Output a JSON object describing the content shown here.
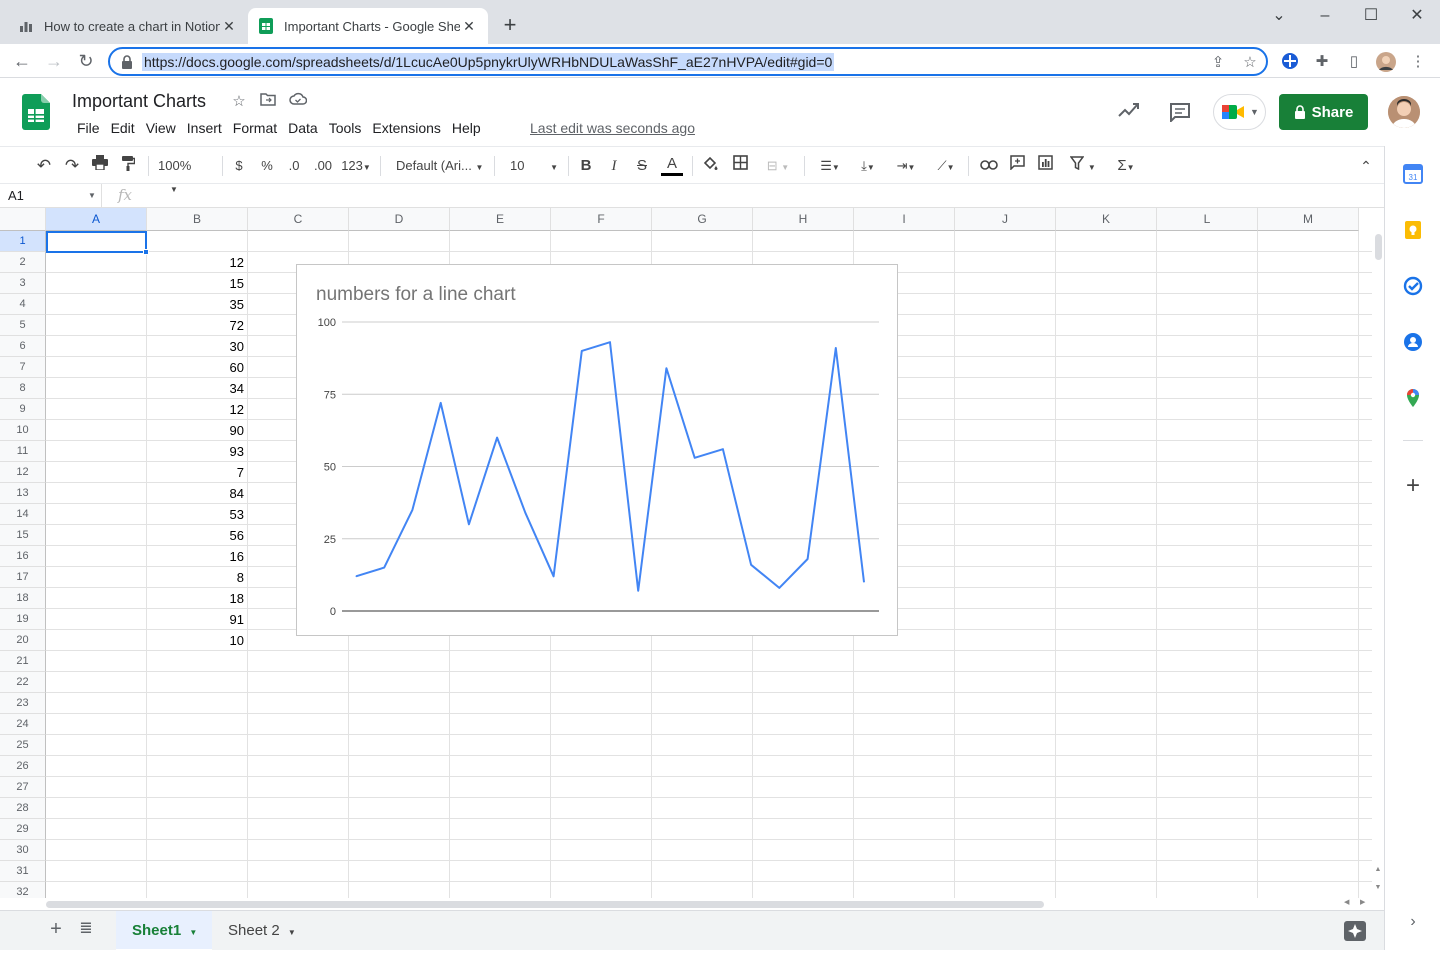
{
  "browser": {
    "tabs": [
      {
        "title": "How to create a chart in Notion",
        "active": false
      },
      {
        "title": "Important Charts - Google Sheet",
        "active": true
      }
    ],
    "url": "https://docs.google.com/spreadsheets/d/1LcucAe0Up5pnykrUlyWRHbNDULaWasShF_aE27nHVPA/edit#gid=0"
  },
  "sheets": {
    "doc_title": "Important Charts",
    "menu": [
      "File",
      "Edit",
      "View",
      "Insert",
      "Format",
      "Data",
      "Tools",
      "Extensions",
      "Help"
    ],
    "last_edit": "Last edit was seconds ago",
    "share_label": "Share",
    "toolbar": {
      "zoom": "100%",
      "currency": "$",
      "percent": "%",
      "dec_decrease": ".0",
      "dec_increase": ".00",
      "number_format": "123",
      "font": "Default (Ari...",
      "font_size": "10",
      "bold": "B",
      "italic": "I",
      "strike": "S",
      "text_color": "A",
      "sum": "Σ"
    },
    "name_box": "A1",
    "fx": "fx",
    "columns": [
      "A",
      "B",
      "C",
      "D",
      "E",
      "F",
      "G",
      "H",
      "I",
      "J",
      "K",
      "L",
      "M"
    ],
    "rows": [
      "1",
      "2",
      "3",
      "4",
      "5",
      "6",
      "7",
      "8",
      "9",
      "10",
      "11",
      "12",
      "13",
      "14",
      "15",
      "16",
      "17",
      "18",
      "19",
      "20",
      "21",
      "22",
      "23",
      "24",
      "25",
      "26",
      "27",
      "28",
      "29",
      "30",
      "31",
      "32"
    ],
    "column_b_values": [
      "12",
      "15",
      "35",
      "72",
      "30",
      "60",
      "34",
      "12",
      "90",
      "93",
      "7",
      "84",
      "53",
      "56",
      "16",
      "8",
      "18",
      "91",
      "10"
    ],
    "sheet_tabs": [
      "Sheet1",
      "Sheet 2"
    ],
    "accent_green": "#188038",
    "accent_blue": "#1a73e8"
  },
  "chart_data": {
    "type": "line",
    "title": "numbers for a line chart",
    "x": [
      1,
      2,
      3,
      4,
      5,
      6,
      7,
      8,
      9,
      10,
      11,
      12,
      13,
      14,
      15,
      16,
      17,
      18,
      19
    ],
    "series": [
      {
        "values": [
          12,
          15,
          35,
          72,
          30,
          60,
          34,
          12,
          90,
          93,
          7,
          84,
          53,
          56,
          16,
          8,
          18,
          91,
          10
        ],
        "color": "#4285f4"
      }
    ],
    "yticks": [
      "0",
      "25",
      "50",
      "75",
      "100"
    ],
    "ylim": [
      0,
      100
    ],
    "grid": true,
    "legend": "none"
  }
}
